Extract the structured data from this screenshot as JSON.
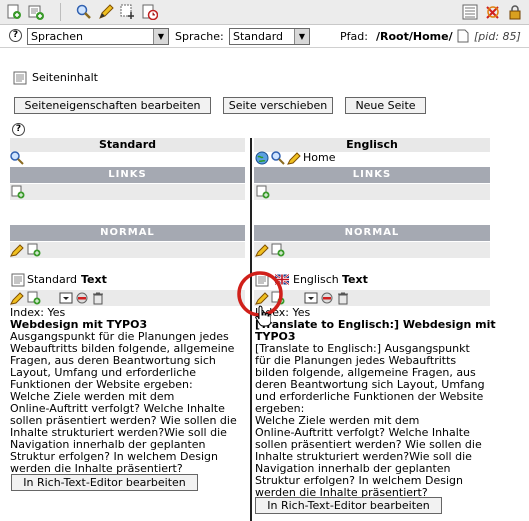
{
  "toolbar": {
    "icons": [
      "new-page-icon",
      "new-content-icon",
      "search-icon",
      "edit-icon",
      "move-icon",
      "history-icon",
      "list-icon",
      "clear-cache-icon",
      "lock-icon"
    ]
  },
  "header": {
    "help": "?",
    "module_select": "Sprachen",
    "language_label": "Sprache:",
    "language_select": "Standard",
    "path_label": "Pfad:",
    "path_value": "/Root/Home/",
    "pid": "[pid: 85]"
  },
  "page": {
    "section_title": "Seiteninhalt",
    "buttons": {
      "edit_props": "Seiteneigenschaften bearbeiten",
      "move_page": "Seite verschieben",
      "new_page": "Neue Seite"
    }
  },
  "columns": {
    "left_title": "Standard",
    "right_title": "Englisch",
    "right_page_label": "Home",
    "links_bar": "LINKS",
    "normal_bar": "NORMAL"
  },
  "left_element": {
    "language": "Standard",
    "type": "Text",
    "index": "Index: Yes",
    "headline": "Webdesign mit TYPO3",
    "body": [
      "Ausgangspunkt für die Planungen jedes",
      "Webauftritts bilden folgende, allgemeine",
      "Fragen, aus deren Beantwortung sich",
      "Layout, Umfang und erforderliche",
      "Funktionen der Website ergeben:",
      "Welche Ziele werden mit dem",
      "Online-Auftritt verfolgt? Welche Inhalte",
      "sollen präsentiert werden? Wie sollen die",
      "Inhalte strukturiert werden?Wie soll die",
      "Navigation innerhalb der geplanten",
      "Struktur erfolgen? In welchem Design",
      "werden die Inhalte präsentiert?"
    ],
    "rte_button": "In Rich-Text-Editor bearbeiten"
  },
  "right_element": {
    "language": "Englisch",
    "type": "Text",
    "index": "Index: Yes",
    "headline": "[Translate to Englisch:] Webdesign mit",
    "headline2": "TYPO3",
    "body": [
      "[Translate to Englisch:] Ausgangspunkt",
      "für die Planungen jedes Webauftritts",
      "bilden folgende, allgemeine Fragen, aus",
      "deren Beantwortung sich Layout, Umfang",
      "und erforderliche Funktionen der Website",
      "ergeben:",
      "Welche Ziele werden mit dem",
      "Online-Auftritt verfolgt? Welche Inhalte",
      "sollen präsentiert werden? Wie sollen die",
      "Inhalte strukturiert werden?Wie soll die",
      "Navigation innerhalb der geplanten",
      "Struktur erfolgen? In welchem Design",
      "werden die Inhalte präsentiert?"
    ],
    "rte_button": "In Rich-Text-Editor bearbeiten"
  },
  "colors": {
    "bar": "#a5a9b2",
    "highlight_circle": "#d0201a"
  }
}
